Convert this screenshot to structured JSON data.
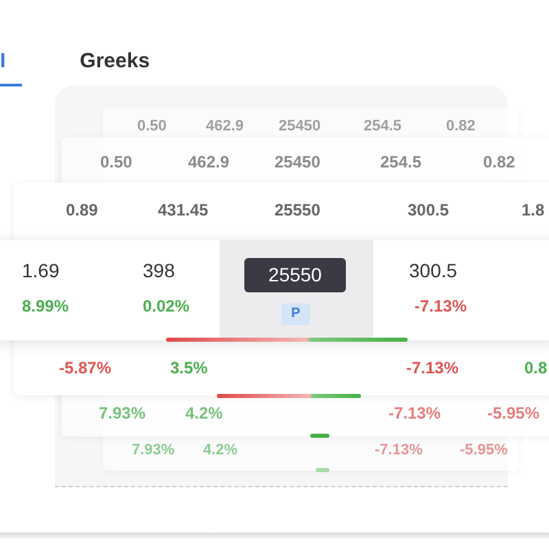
{
  "tabs": [
    {
      "label": "I",
      "selected": true
    },
    {
      "label": "Greeks",
      "selected": false
    }
  ],
  "layers": [
    {
      "top_row": [
        "0.50",
        "462.9",
        "25450",
        "254.5",
        "0.82"
      ],
      "bottom_row": [
        {
          "text": "7.93%",
          "positive": true
        },
        {
          "text": "4.2%",
          "positive": true
        },
        {
          "text": "-7.13%",
          "positive": false
        },
        {
          "text": "-5.95%",
          "positive": false
        }
      ]
    },
    {
      "top_row": [
        "0.50",
        "462.9",
        "25450",
        "254.5",
        "0.82"
      ],
      "bottom_row": [
        {
          "text": "7.93%",
          "positive": true
        },
        {
          "text": "4.2%",
          "positive": true
        },
        {
          "text": "-7.13%",
          "positive": false
        },
        {
          "text": "-5.95%",
          "positive": false
        }
      ]
    },
    {
      "top_row": [
        "0.89",
        "431.45",
        "25550",
        "300.5",
        "1.8"
      ],
      "bottom_row": [
        {
          "text": "-5.87%",
          "positive": false
        },
        {
          "text": "3.5%",
          "positive": true
        },
        {
          "text": "-7.13%",
          "positive": false
        },
        {
          "text": "0.8",
          "positive": true
        }
      ]
    }
  ],
  "front": {
    "calls": [
      {
        "price": "1.69",
        "change": "8.99%",
        "positive": true
      },
      {
        "price": "398",
        "change": "0.02%",
        "positive": true
      }
    ],
    "strike": {
      "value": "25550",
      "badge": "P"
    },
    "puts": [
      {
        "price": "300.5",
        "change": "-7.13%",
        "positive": false
      }
    ]
  }
}
